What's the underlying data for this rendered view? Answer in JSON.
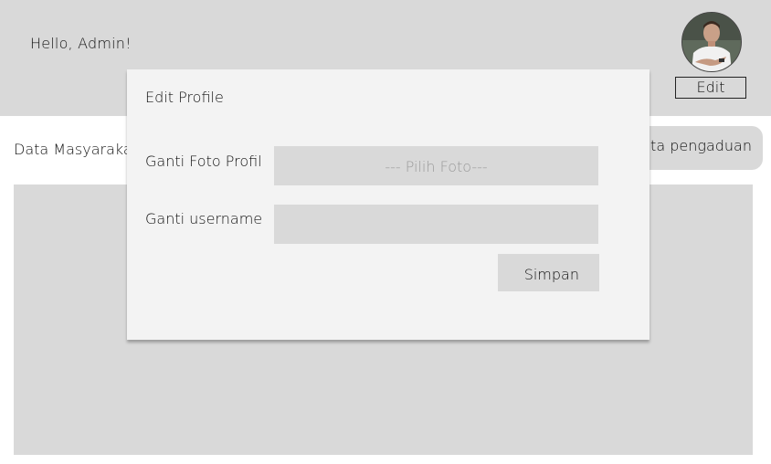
{
  "header": {
    "greeting": "Hello, Admin!",
    "avatar_icon": "user-avatar-photo",
    "edit_label": "Edit"
  },
  "main": {
    "section_label": "Data Masyarakat",
    "report_button_label": "Data pengaduan"
  },
  "modal": {
    "title": "Edit Profile",
    "photo_label": "Ganti Foto Profil",
    "photo_placeholder": "--- Pilih Foto---",
    "username_label": "Ganti username",
    "username_value": "",
    "save_label": "Simpan"
  },
  "colors": {
    "panel_gray": "#d9d9d9",
    "modal_bg": "#f3f3f3",
    "page_bg": "#ffffff"
  }
}
